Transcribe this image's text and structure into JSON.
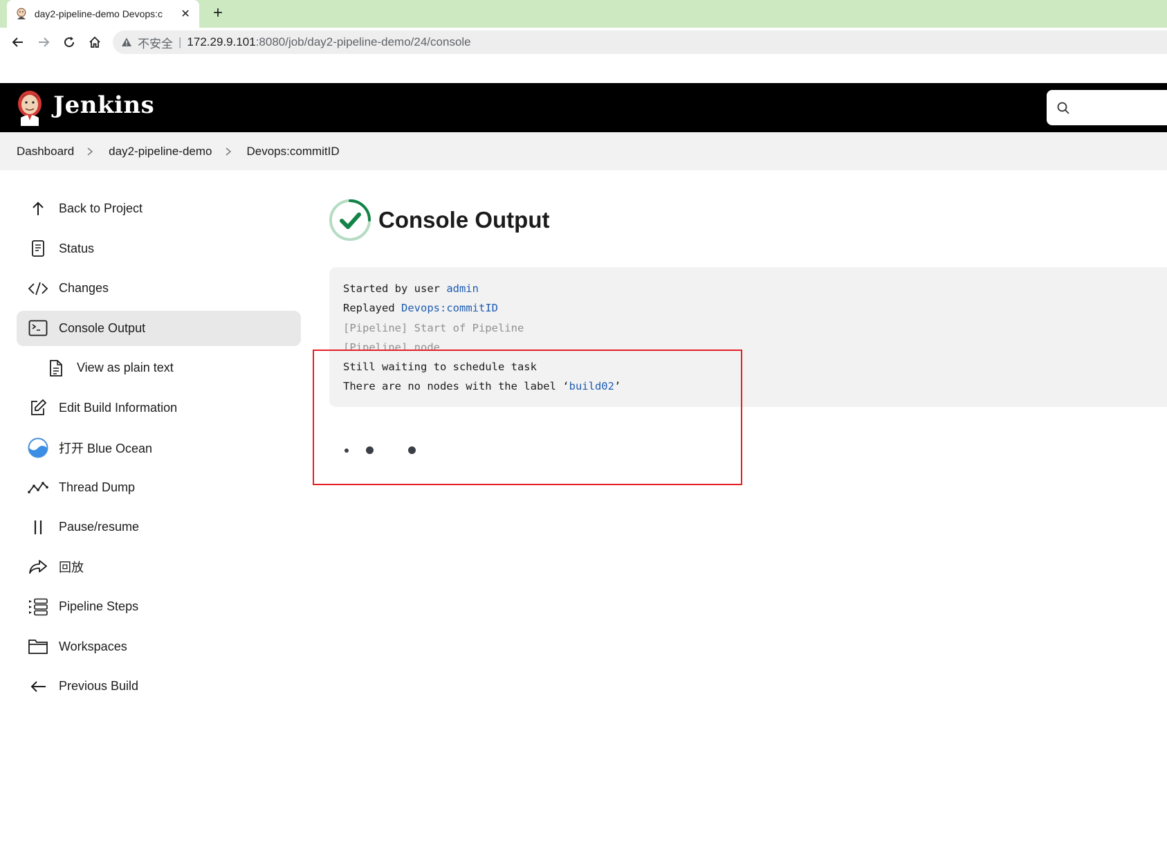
{
  "browser": {
    "tab_title": "day2-pipeline-demo Devops:c",
    "insecure_label": "不安全",
    "separator": "|",
    "url_host": "172.29.9.101",
    "url_path": ":8080/job/day2-pipeline-demo/24/console"
  },
  "header": {
    "brand": "Jenkins"
  },
  "breadcrumb": [
    {
      "label": "Dashboard"
    },
    {
      "label": "day2-pipeline-demo"
    },
    {
      "label": "Devops:commitID"
    }
  ],
  "sidebar": {
    "items": [
      {
        "label": "Back to Project",
        "icon": "arrow-up-icon"
      },
      {
        "label": "Status",
        "icon": "document-icon"
      },
      {
        "label": "Changes",
        "icon": "code-icon"
      },
      {
        "label": "Console Output",
        "icon": "terminal-icon",
        "active": true
      },
      {
        "label": "View as plain text",
        "icon": "file-text-icon"
      },
      {
        "label": "Edit Build Information",
        "icon": "edit-icon"
      },
      {
        "label": "打开 Blue Ocean",
        "icon": "blue-ocean-icon"
      },
      {
        "label": "Thread Dump",
        "icon": "activity-icon"
      },
      {
        "label": "Pause/resume",
        "icon": "pause-icon"
      },
      {
        "label": "回放",
        "icon": "share-arrow-icon"
      },
      {
        "label": "Pipeline Steps",
        "icon": "list-steps-icon"
      },
      {
        "label": "Workspaces",
        "icon": "folder-icon"
      },
      {
        "label": "Previous Build",
        "icon": "arrow-left-icon"
      }
    ]
  },
  "main": {
    "title": "Console Output",
    "status_icon": "success-check-icon",
    "status_color": "#138347",
    "console": {
      "line1_prefix": "Started by user ",
      "line1_link": "admin",
      "line2_prefix": "Replayed ",
      "line2_link": "Devops:commitID",
      "line3": "[Pipeline] Start of Pipeline",
      "line4": "[Pipeline] node",
      "line5": "Still waiting to schedule task",
      "line6_prefix": "There are no nodes with the label ‘",
      "line6_link": "build02",
      "line6_suffix": "’"
    }
  },
  "colors": {
    "tabstrip": "#cde9c1",
    "header_bg": "#000000",
    "link": "#1d5cb0",
    "highlight_box": "#e51e25"
  }
}
